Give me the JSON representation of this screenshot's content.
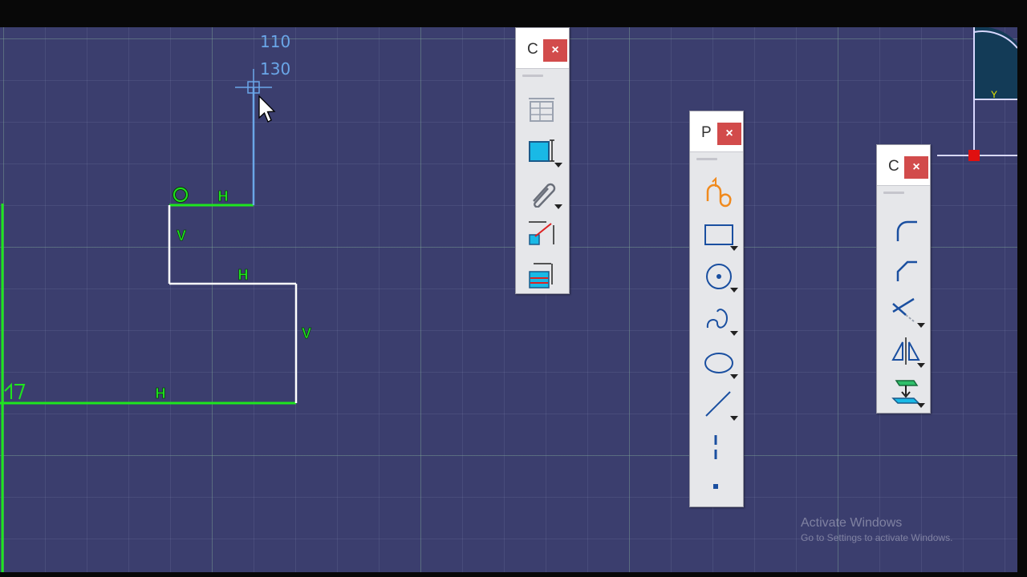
{
  "cursor_readout": {
    "h_value": "110",
    "v_value": "130"
  },
  "constraints": {
    "horizontal_symbol": "H",
    "vertical_symbol": "V"
  },
  "toolbars": {
    "constraint": {
      "title": "C",
      "close_label": "×",
      "tools": [
        {
          "icon": "constraint-grid-icon"
        },
        {
          "icon": "constraint-dialog-icon",
          "has_dropdown": true
        },
        {
          "icon": "auto-constraint-paperclip-icon",
          "has_dropdown": true
        },
        {
          "icon": "animate-constraint-icon"
        },
        {
          "icon": "edit-multi-constraint-icon"
        }
      ]
    },
    "profile": {
      "title": "P",
      "close_label": "×",
      "tools": [
        {
          "icon": "profile-icon"
        },
        {
          "icon": "rectangle-icon",
          "has_dropdown": true
        },
        {
          "icon": "circle-icon",
          "has_dropdown": true
        },
        {
          "icon": "spline-icon",
          "has_dropdown": true
        },
        {
          "icon": "ellipse-icon",
          "has_dropdown": true
        },
        {
          "icon": "line-icon",
          "has_dropdown": true
        },
        {
          "icon": "axis-icon"
        },
        {
          "icon": "point-icon"
        }
      ]
    },
    "operation": {
      "title": "C",
      "close_label": "×",
      "tools": [
        {
          "icon": "corner-icon"
        },
        {
          "icon": "chamfer-icon"
        },
        {
          "icon": "trim-icon",
          "has_dropdown": true
        },
        {
          "icon": "mirror-icon",
          "has_dropdown": true
        },
        {
          "icon": "project-3d-elements-icon",
          "has_dropdown": true
        }
      ]
    }
  },
  "watermark": {
    "line1": "Activate Windows",
    "line2": "Go to Settings to activate Windows."
  },
  "axis_label": "Y",
  "colors": {
    "background": "#3b3e6e",
    "constrained_geometry": "#1ee61e",
    "unconstrained_geometry": "#ffffff",
    "active_line": "#6aa6e8",
    "close_button": "#d24b4b",
    "origin_point": "#e01010"
  }
}
